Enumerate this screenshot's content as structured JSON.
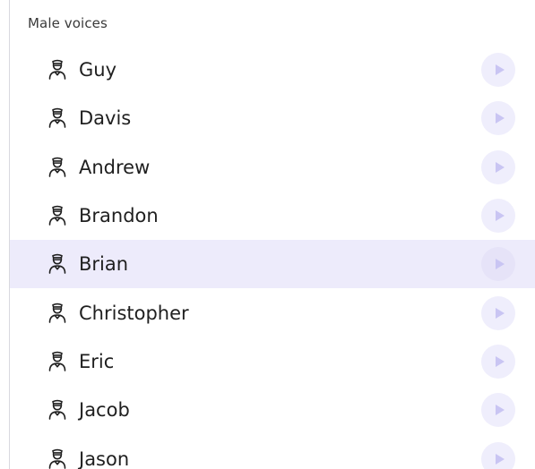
{
  "section": {
    "title": "Male voices"
  },
  "voices": [
    {
      "name": "Guy",
      "selected": false,
      "icon": "person-icon",
      "action_icon": "play-icon"
    },
    {
      "name": "Davis",
      "selected": false,
      "icon": "person-icon",
      "action_icon": "play-icon"
    },
    {
      "name": "Andrew",
      "selected": false,
      "icon": "person-icon",
      "action_icon": "play-icon"
    },
    {
      "name": "Brandon",
      "selected": false,
      "icon": "person-icon",
      "action_icon": "play-icon"
    },
    {
      "name": "Brian",
      "selected": true,
      "icon": "person-icon",
      "action_icon": "play-icon"
    },
    {
      "name": "Christopher",
      "selected": false,
      "icon": "person-icon",
      "action_icon": "play-icon"
    },
    {
      "name": "Eric",
      "selected": false,
      "icon": "person-icon",
      "action_icon": "play-icon"
    },
    {
      "name": "Jacob",
      "selected": false,
      "icon": "person-icon",
      "action_icon": "play-icon"
    },
    {
      "name": "Jason",
      "selected": false,
      "icon": "person-icon",
      "action_icon": "play-icon"
    }
  ],
  "colors": {
    "selected_row": "#edebfb",
    "play_button_bg": "#efeefc",
    "play_glyph": "#c9c5f3",
    "text": "#1f1f1f",
    "divider": "#d9d9df"
  }
}
